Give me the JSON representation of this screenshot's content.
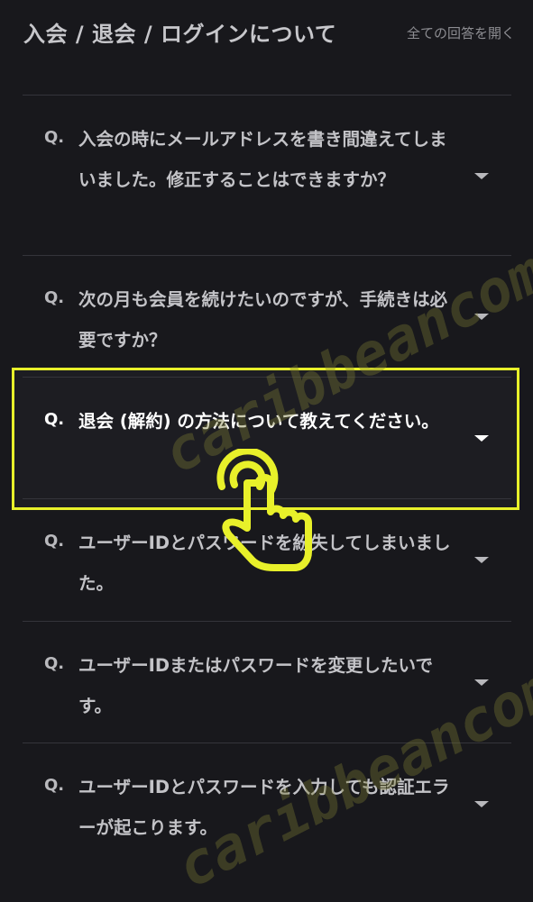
{
  "header": {
    "title": "入会 / 退会 / ログインについて",
    "open_all_label": "全ての回答を開く"
  },
  "faq": [
    {
      "q": "Q.",
      "text": "入会の時にメールアドレスを書き間違えてしまいました。修正することはできますか？"
    },
    {
      "q": "Q.",
      "text": "次の月も会員を続けたいのですが、手続きは必要ですか？"
    },
    {
      "q": "Q.",
      "text": "退会 (解約) の方法について教えてください。"
    },
    {
      "q": "Q.",
      "text": "ユーザーIDとパスワードを紛失してしまいました。"
    },
    {
      "q": "Q.",
      "text": "ユーザーIDまたはパスワードを変更したいです。"
    },
    {
      "q": "Q.",
      "text": "ユーザーIDとパスワードを入力しても認証エラーが起こります。"
    }
  ],
  "watermark": {
    "text_1": "caribbeancom-cou",
    "text_2": "caribbeancom-cou"
  },
  "colors": {
    "background": "#18181c",
    "highlight": "#e8f02a",
    "watermark": "#787832"
  },
  "icons": {
    "chevron": "chevron-down-icon",
    "pointer": "tap-hand-icon"
  }
}
